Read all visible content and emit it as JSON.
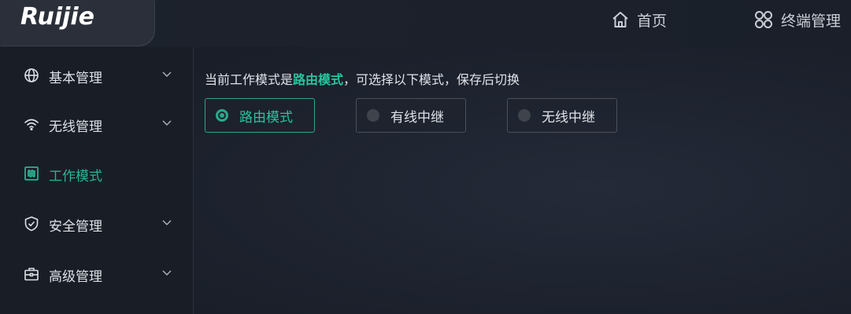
{
  "header": {
    "logo_text": "Ruijie",
    "nav": [
      {
        "label": "首页",
        "icon": "home-icon"
      },
      {
        "label": "终端管理",
        "icon": "terminal-management-icon"
      }
    ]
  },
  "sidebar": {
    "items": [
      {
        "label": "基本管理",
        "icon": "globe-icon",
        "has_submenu": true,
        "active": false
      },
      {
        "label": "无线管理",
        "icon": "wifi-icon",
        "has_submenu": true,
        "active": false
      },
      {
        "label": "工作模式",
        "icon": "work-mode-icon",
        "has_submenu": false,
        "active": true
      },
      {
        "label": "安全管理",
        "icon": "shield-icon",
        "has_submenu": true,
        "active": false
      },
      {
        "label": "高级管理",
        "icon": "toolbox-icon",
        "has_submenu": true,
        "active": false
      }
    ]
  },
  "main": {
    "prompt_prefix": "当前工作模式是",
    "prompt_mode": "路由模式",
    "prompt_suffix": "，可选择以下模式，保存后切换",
    "modes": [
      {
        "label": "路由模式",
        "selected": true
      },
      {
        "label": "有线中继",
        "selected": false
      },
      {
        "label": "无线中继",
        "selected": false
      }
    ]
  },
  "colors": {
    "accent": "#2bc39e",
    "background": "#1b202b",
    "sidebar": "#191d26"
  }
}
